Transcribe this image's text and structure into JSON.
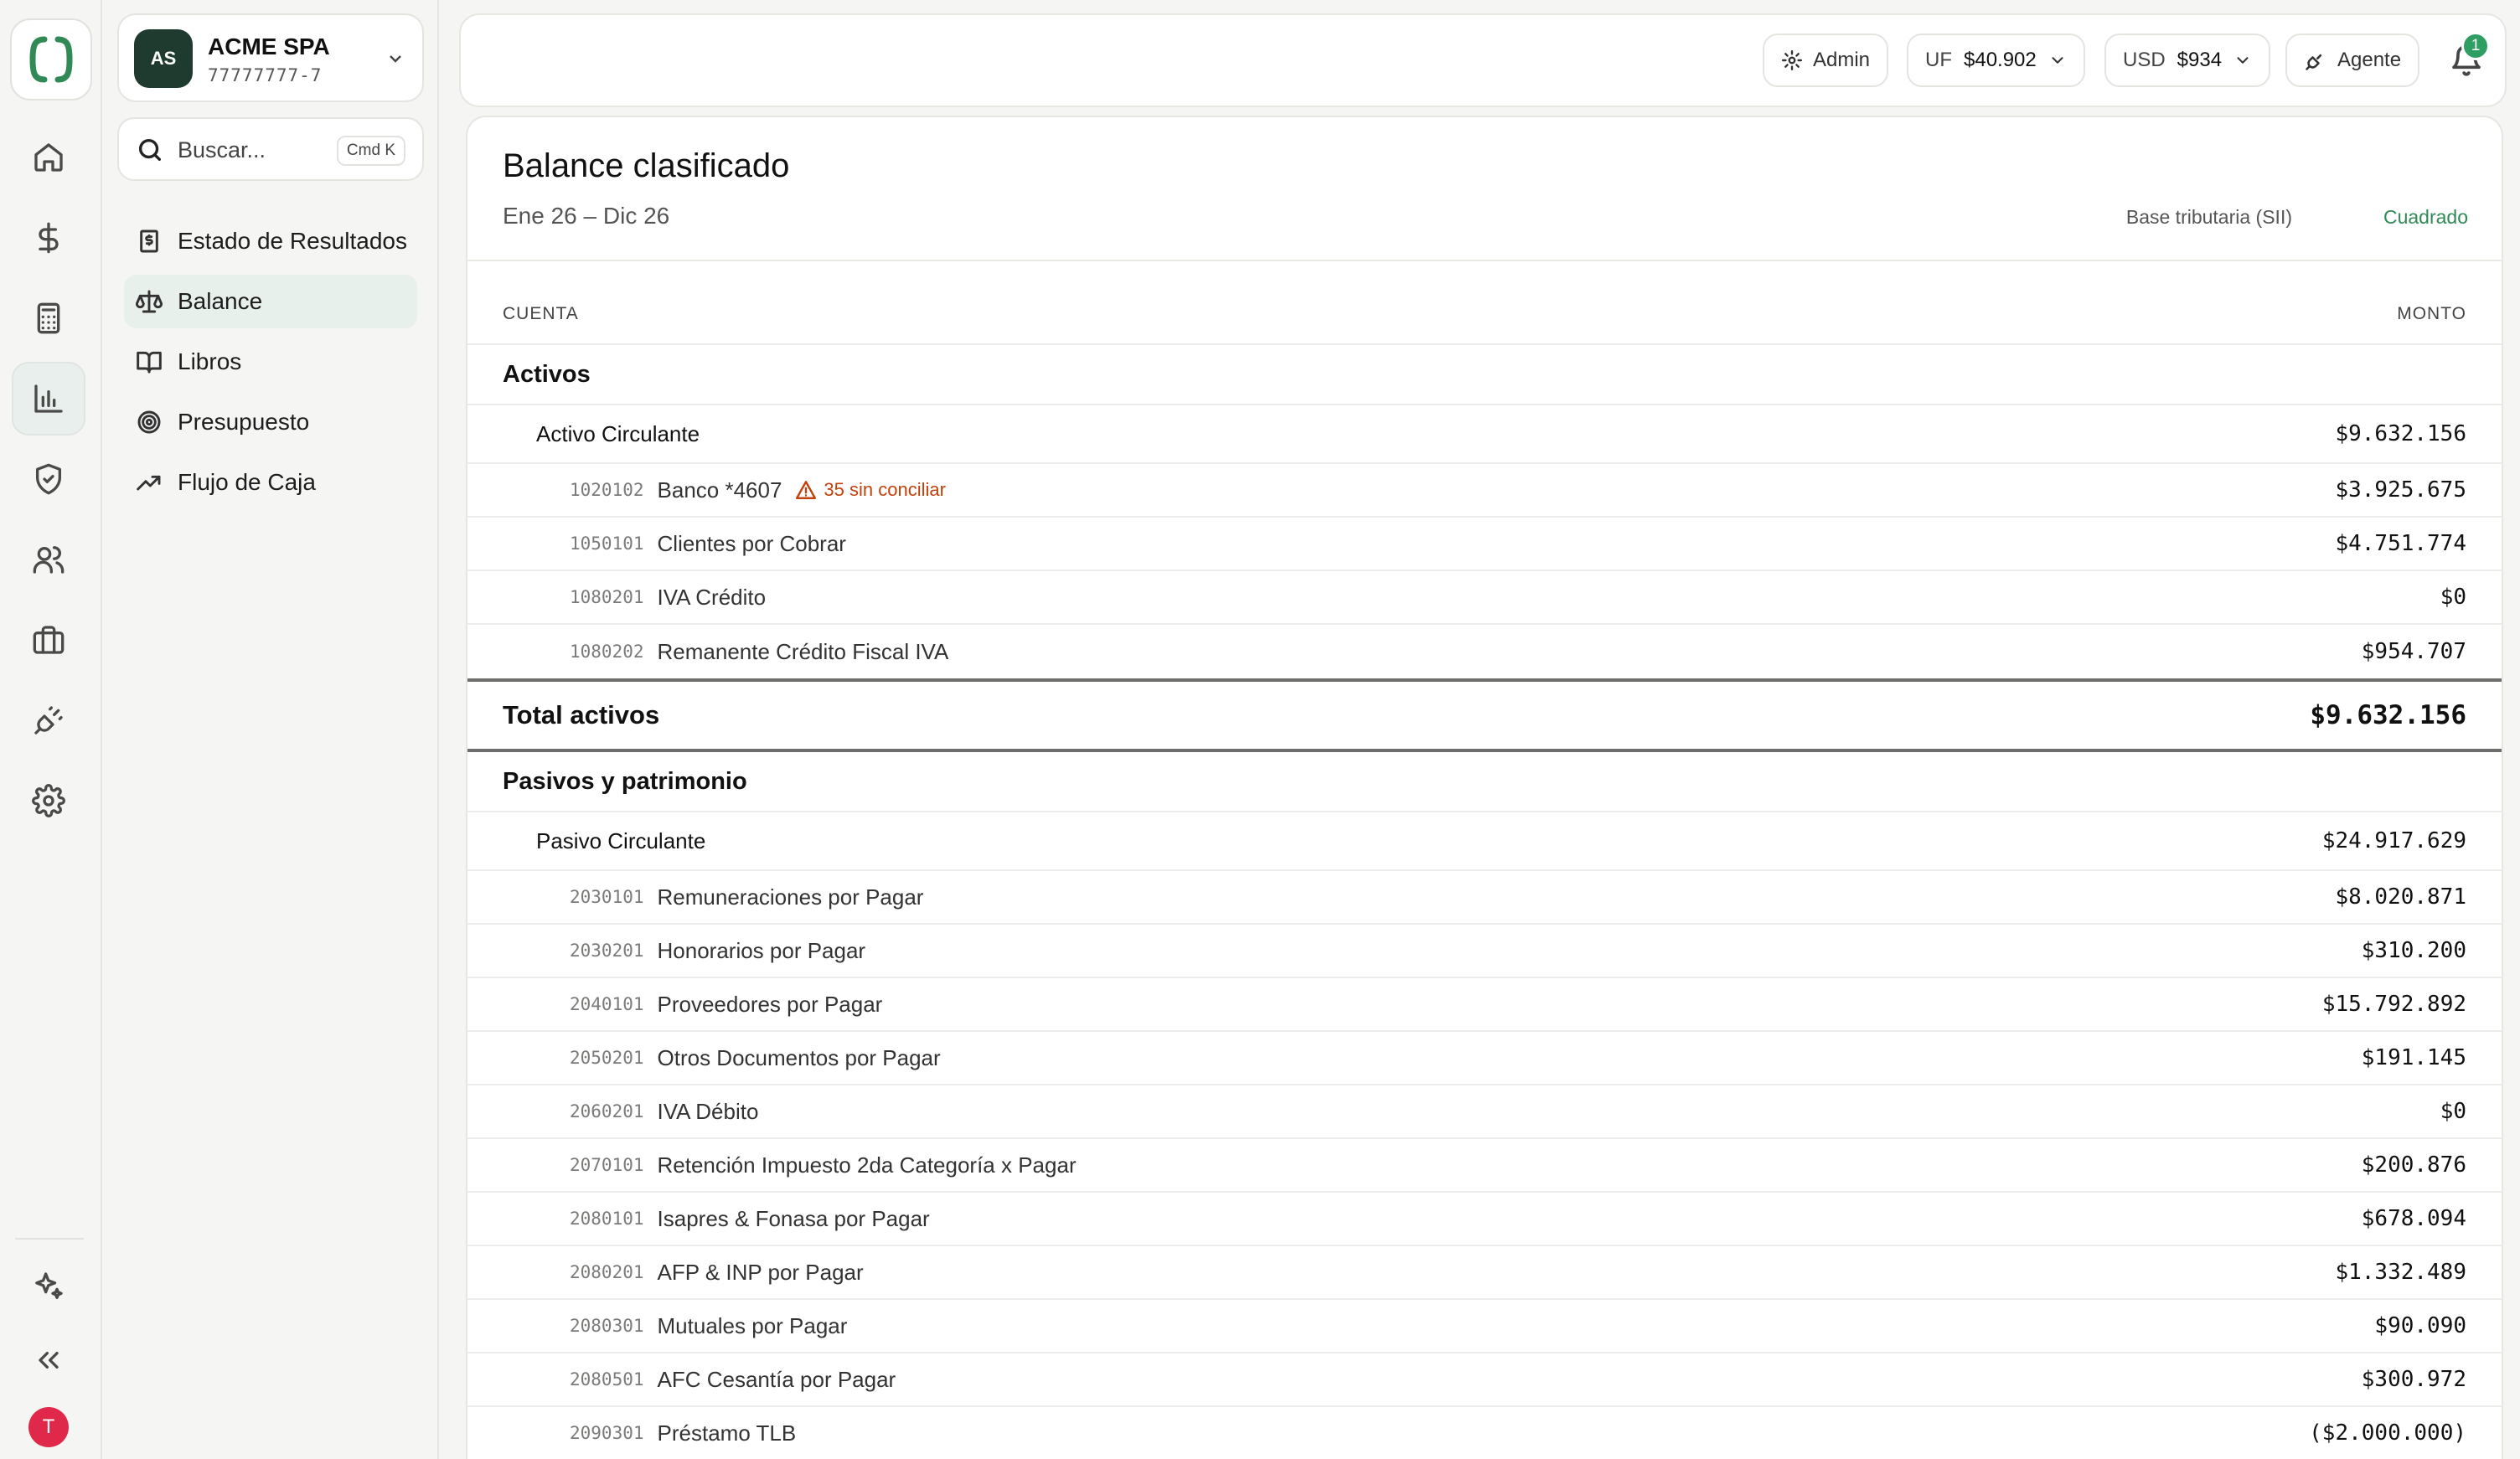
{
  "company": {
    "initials": "AS",
    "name": "ACME SPA",
    "rut": "77777777-7"
  },
  "search": {
    "placeholder": "Buscar...",
    "shortcut": "Cmd K"
  },
  "sidebar": {
    "items": [
      {
        "label": "Estado de Resultados",
        "icon": "receipt-icon"
      },
      {
        "label": "Balance",
        "icon": "scale-icon",
        "active": true
      },
      {
        "label": "Libros",
        "icon": "book-icon"
      },
      {
        "label": "Presupuesto",
        "icon": "target-icon"
      },
      {
        "label": "Flujo de Caja",
        "icon": "trending-up-icon"
      }
    ]
  },
  "rail": {
    "icons": [
      "home-icon",
      "dollar-icon",
      "calculator-icon",
      "chart-bar-icon",
      "shield-icon",
      "users-icon",
      "briefcase-icon",
      "plug-icon",
      "settings-icon",
      "sparkles-icon",
      "collapse-icon"
    ],
    "avatar_initial": "T",
    "avatar_color": "#e0284a"
  },
  "topbar": {
    "admin_label": "Admin",
    "uf_key": "UF",
    "uf_value": "$40.902",
    "usd_key": "USD",
    "usd_value": "$934",
    "agent_label": "Agente",
    "notification_count": "1"
  },
  "report": {
    "title": "Balance clasificado",
    "range": "Ene 26 – Dic 26",
    "basis": "Base tributaria (SII)",
    "status": "Cuadrado",
    "col_account": "CUENTA",
    "col_amount": "MONTO",
    "assets": {
      "section": "Activos",
      "group": "Activo Circulante",
      "group_total": "$9.632.156",
      "accounts": [
        {
          "code": "1020102",
          "name": "Banco *4607",
          "warning": "35 sin conciliar",
          "amount": "$3.925.675"
        },
        {
          "code": "1050101",
          "name": "Clientes por Cobrar",
          "amount": "$4.751.774"
        },
        {
          "code": "1080201",
          "name": "IVA Crédito",
          "amount": "$0"
        },
        {
          "code": "1080202",
          "name": "Remanente Crédito Fiscal IVA",
          "amount": "$954.707"
        }
      ],
      "total_label": "Total activos",
      "total": "$9.632.156"
    },
    "liabilities": {
      "section": "Pasivos y patrimonio",
      "group": "Pasivo Circulante",
      "group_total": "$24.917.629",
      "accounts": [
        {
          "code": "2030101",
          "name": "Remuneraciones por Pagar",
          "amount": "$8.020.871"
        },
        {
          "code": "2030201",
          "name": "Honorarios por Pagar",
          "amount": "$310.200"
        },
        {
          "code": "2040101",
          "name": "Proveedores por Pagar",
          "amount": "$15.792.892"
        },
        {
          "code": "2050201",
          "name": "Otros Documentos por Pagar",
          "amount": "$191.145"
        },
        {
          "code": "2060201",
          "name": "IVA Débito",
          "amount": "$0"
        },
        {
          "code": "2070101",
          "name": "Retención Impuesto 2da Categoría x Pagar",
          "amount": "$200.876"
        },
        {
          "code": "2080101",
          "name": "Isapres & Fonasa por Pagar",
          "amount": "$678.094"
        },
        {
          "code": "2080201",
          "name": "AFP & INP por Pagar",
          "amount": "$1.332.489"
        },
        {
          "code": "2080301",
          "name": "Mutuales por Pagar",
          "amount": "$90.090"
        },
        {
          "code": "2080501",
          "name": "AFC Cesantía por Pagar",
          "amount": "$300.972"
        },
        {
          "code": "2090301",
          "name": "Préstamo TLB",
          "amount": "($2.000.000)"
        }
      ]
    }
  }
}
